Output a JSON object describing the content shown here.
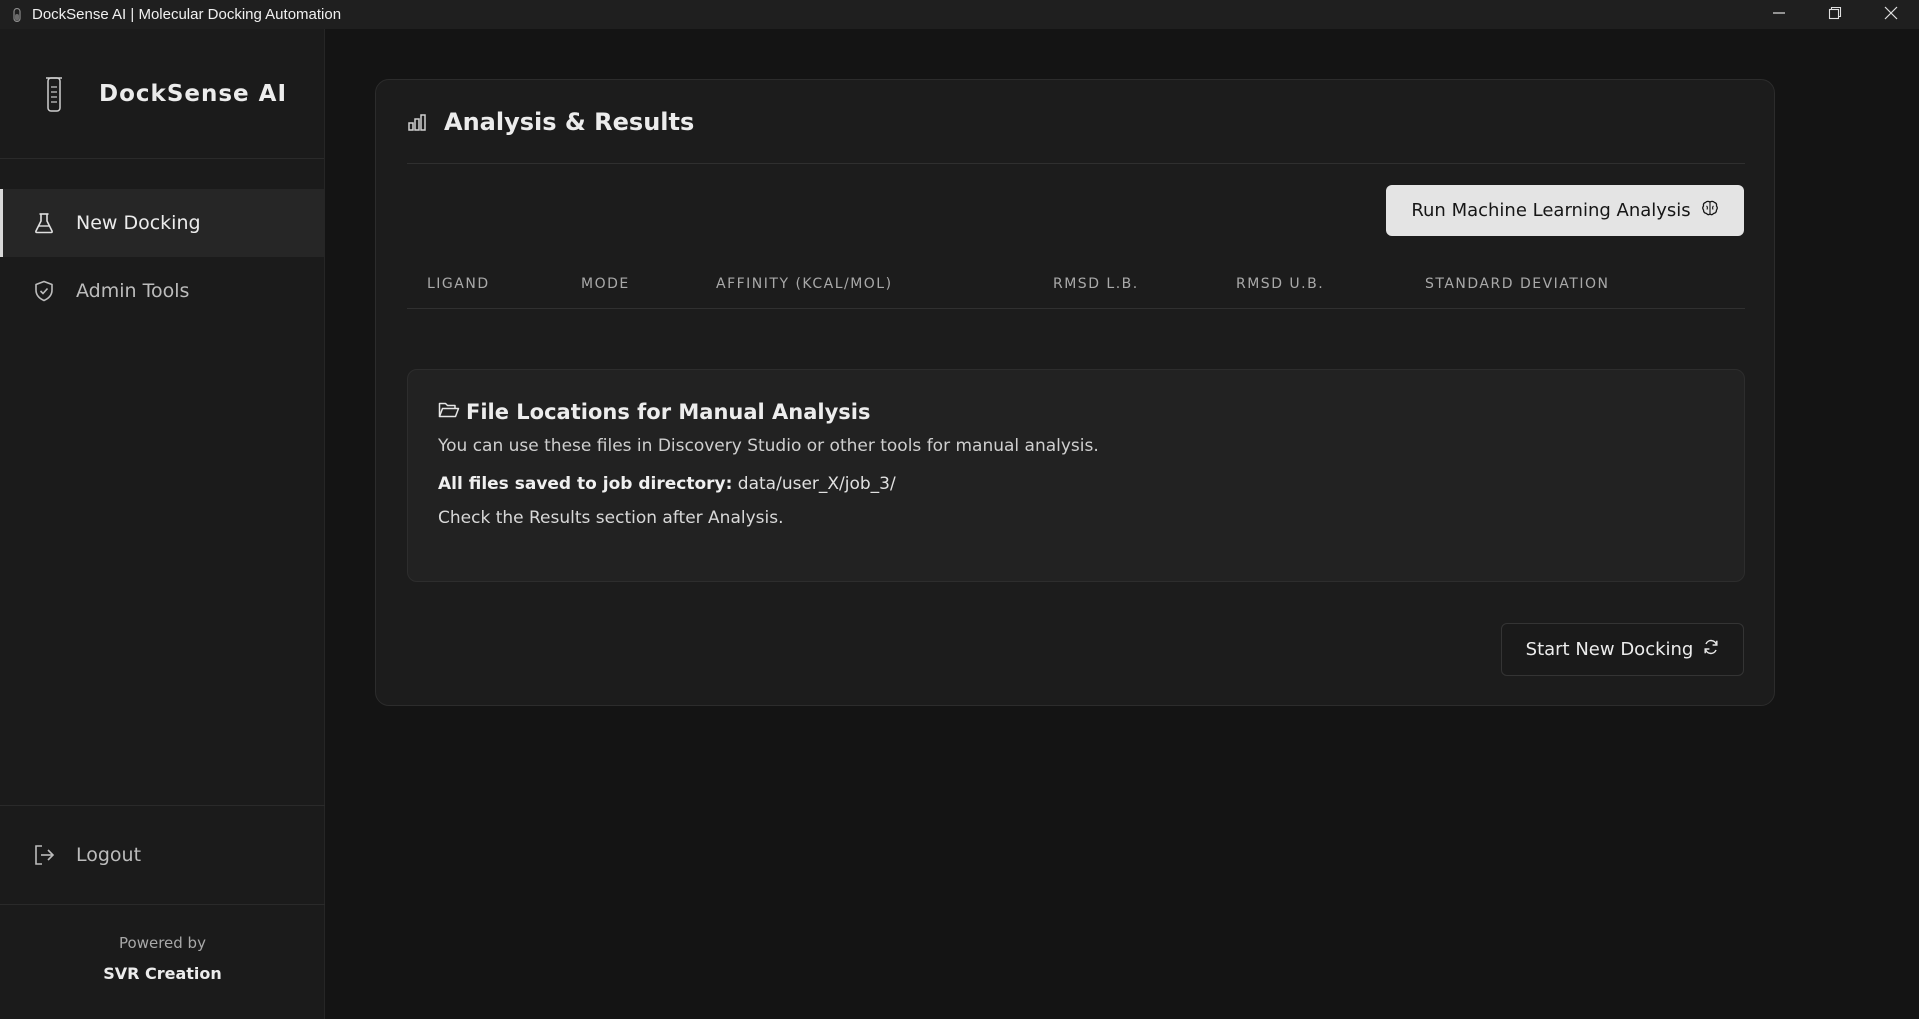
{
  "window": {
    "title": "DockSense AI | Molecular Docking Automation",
    "icons": {
      "app": "test-tube-icon",
      "minimize": "minimize-icon",
      "maximize": "restore-icon",
      "close": "close-icon"
    }
  },
  "sidebar": {
    "brand": {
      "name": "DockSense AI",
      "icon": "test-tube-icon"
    },
    "items": [
      {
        "label": "New Docking",
        "icon": "flask-icon",
        "active": true
      },
      {
        "label": "Admin Tools",
        "icon": "shield-check-icon",
        "active": false
      }
    ],
    "logout": {
      "label": "Logout",
      "icon": "logout-icon"
    },
    "footer": {
      "powered_by": "Powered by",
      "company": "SVR Creation"
    }
  },
  "main": {
    "title": "Analysis & Results",
    "title_icon": "bar-chart-icon",
    "ml_button": {
      "label": "Run Machine Learning Analysis",
      "icon": "brain-icon"
    },
    "table": {
      "columns": [
        "Ligand",
        "Mode",
        "Affinity (kcal/mol)",
        "RMSD l.b.",
        "RMSD u.b.",
        "Standard Deviation"
      ],
      "rows": []
    },
    "files": {
      "icon": "folder-open-icon",
      "title": "File Locations for Manual Analysis",
      "description": "You can use these files in Discovery Studio or other tools for manual analysis.",
      "dir_label": "All files saved to job directory:",
      "dir_value": "data/user_X/job_3/",
      "note": "Check the Results section after Analysis."
    },
    "new_docking_button": {
      "label": "Start New Docking",
      "icon": "refresh-icon"
    }
  },
  "colors": {
    "background": "#141414",
    "sidebar": "#1b1b1b",
    "card": "#1c1c1c",
    "primary_button": "#e4e4e4",
    "text": "#ececec",
    "muted": "#a9a9a9"
  }
}
